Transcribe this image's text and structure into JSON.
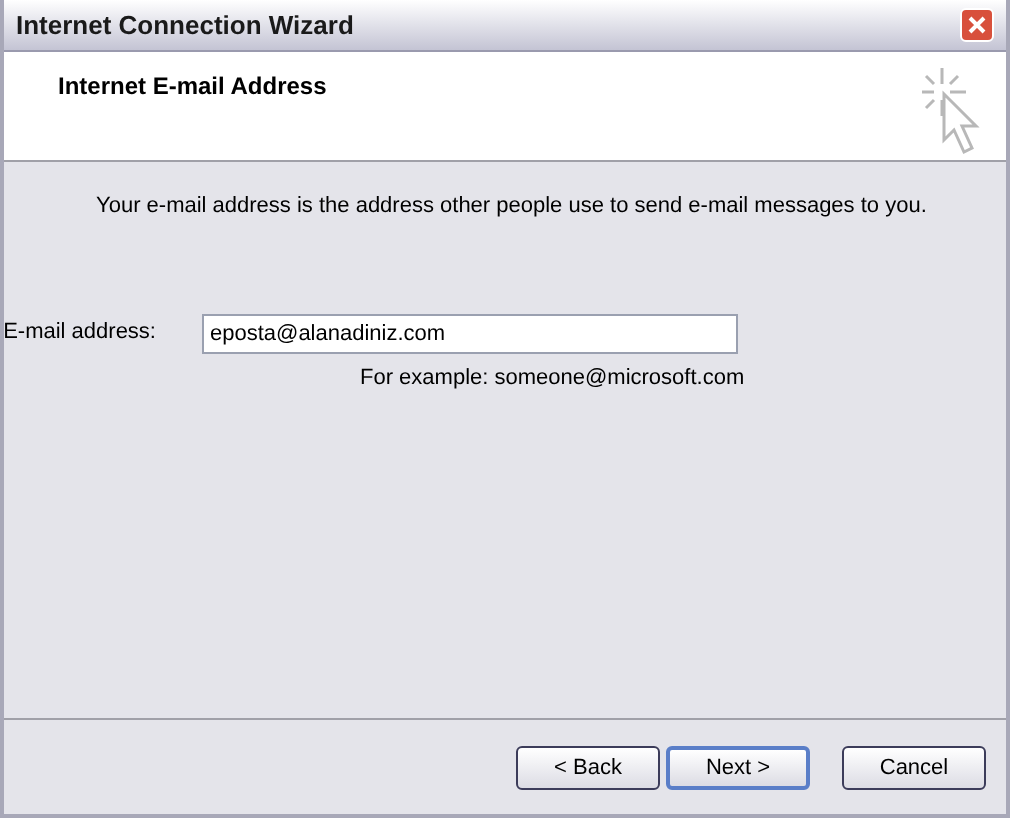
{
  "window": {
    "title": "Internet Connection Wizard"
  },
  "header": {
    "title": "Internet E-mail Address"
  },
  "description": "Your e-mail address is the address other people use to send e-mail messages to you.",
  "email_field": {
    "label": "E-mail address:",
    "value": "eposta@alanadiniz.com",
    "hint": "For example: someone@microsoft.com"
  },
  "buttons": [
    {
      "label": "< Back",
      "default": false
    },
    {
      "label": "Next >",
      "default": true
    },
    {
      "label": "Cancel",
      "default": false
    }
  ]
}
